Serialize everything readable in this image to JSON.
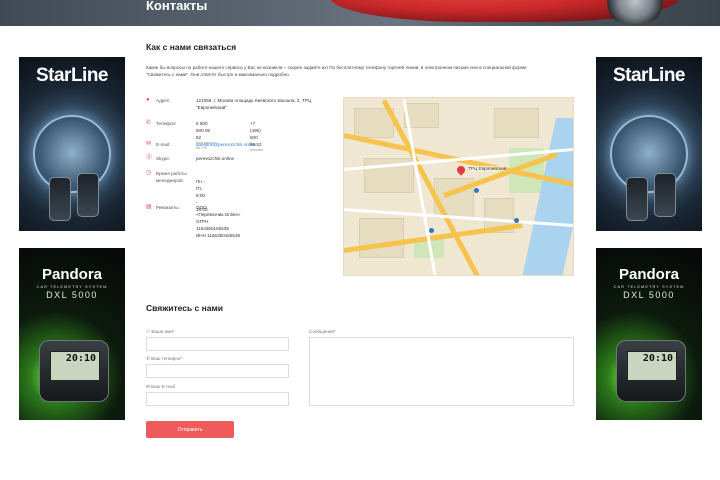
{
  "hero": {
    "title": "Контакты"
  },
  "banners": {
    "starline_brand": "StarLine",
    "pandora_brand": "Pandora",
    "pandora_sub": "CAR TELEMETRY SYSTEM",
    "pandora_model": "DXL 5000",
    "pandora_screen": "20:10"
  },
  "contact": {
    "heading": "Как с нами связаться",
    "intro": "Какие бы вопросы по работе нашего сервиса у Вас не возникли – скорее задайте их! По бесплатному телефону горячей линии, в электронном письме или в специальной форме \"Свяжитесь с нами\". Они ответят быстро и максимально подробно.",
    "rows": [
      {
        "icon": "map-marker-icon",
        "label": "Адрес:",
        "value": "121059, г. Москва площадь Киевского вокзала, 2, ТРЦ \"Европейский\""
      },
      {
        "icon": "phone-icon",
        "label": "Телефон:",
        "value": "8 800 500 06 52",
        "value_hint": "Бесплатно по РФ",
        "value2": "+7 (495) 500 06 52",
        "value2_hint": "Москва"
      },
      {
        "icon": "envelope-icon",
        "label": "E-mail:",
        "value": "question@perevozchik.online"
      },
      {
        "icon": "skype-icon",
        "label": "Skype:",
        "value": "perevozchik.online"
      },
      {
        "icon": "clock-icon",
        "label": "Время работы менеджеров:",
        "value": "Пн - Пт, 9:00 - 18:00"
      },
      {
        "icon": "document-icon",
        "label": "Реквизиты:",
        "value": "ООО «Перевозчик.Online»",
        "value_line2": "ОГРН 1164350155535",
        "value_line3": "ИНН 1166350155535"
      }
    ]
  },
  "map": {
    "pin_label": "ТРЦ Европейский"
  },
  "form": {
    "heading": "Свяжитесь с нами",
    "name_label": "Ваше имя",
    "phone_label": "Ваш телефон",
    "email_label": "Ваш E-mail",
    "message_label": "Сообщение",
    "required_mark": "*",
    "submit_label": "Отправить"
  },
  "colors": {
    "accent": "#ef5a5a",
    "link": "#2b7bd8",
    "icon": "#e35454"
  }
}
